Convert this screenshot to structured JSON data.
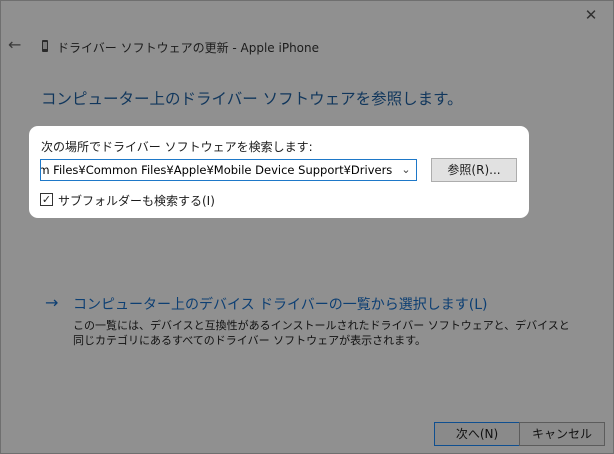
{
  "window": {
    "title": "ドライバー ソフトウェアの更新 - Apple iPhone",
    "close_glyph": "✕",
    "back_glyph": "←"
  },
  "page": {
    "heading": "コンピューター上のドライバー ソフトウェアを参照します。"
  },
  "search": {
    "label": "次の場所でドライバー ソフトウェアを検索します:",
    "path_value": "Program Files¥Common Files¥Apple¥Mobile Device Support¥Drivers",
    "dropdown_glyph": "⌄",
    "browse_label": "参照(R)...",
    "include_subfolders_label": "サブフォルダーも検索する(I)",
    "include_subfolders_checked": true,
    "check_glyph": "✓"
  },
  "pick_list": {
    "arrow_glyph": "→",
    "link_label": "コンピューター上のデバイス ドライバーの一覧から選択します(L)",
    "description": "この一覧には、デバイスと互換性があるインストールされたドライバー ソフトウェアと、デバイスと同じカテゴリにあるすべてのドライバー ソフトウェアが表示されます。"
  },
  "footer": {
    "next_label": "次へ(N)",
    "cancel_label": "キャンセル"
  },
  "colors": {
    "dim_background": "#909090",
    "heading": "#10365c",
    "link": "#0d3f73",
    "focus_border": "#1e78c8"
  }
}
